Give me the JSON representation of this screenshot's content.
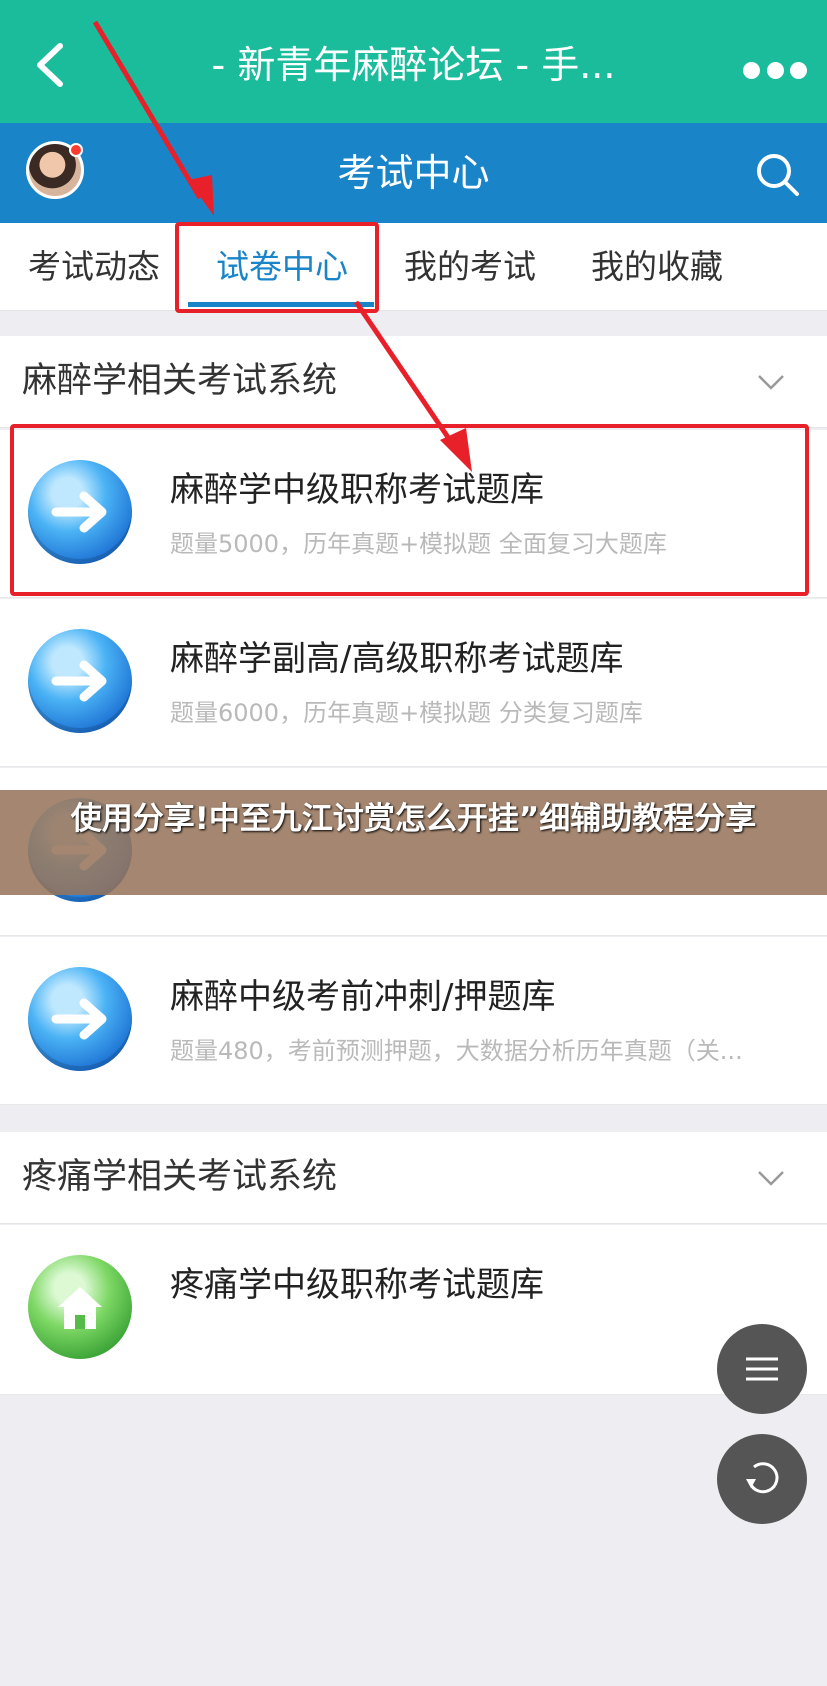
{
  "topbar": {
    "title": "- 新青年麻醉论坛 - 手..."
  },
  "header": {
    "title": "考试中心"
  },
  "tabs": [
    {
      "label": "考试动态"
    },
    {
      "label": "试卷中心"
    },
    {
      "label": "我的考试"
    },
    {
      "label": "我的收藏"
    }
  ],
  "sections": [
    {
      "title": "麻醉学相关考试系统",
      "items": [
        {
          "title": "麻醉学中级职称考试题库",
          "subtitle": "题量5000，历年真题+模拟题 全面复习大题库"
        },
        {
          "title": "麻醉学副高/高级职称考试题库",
          "subtitle": "题量6000，历年真题+模拟题 分类复习题库"
        },
        {
          "title": "麻醉中级考前冲刺/押题库",
          "subtitle": "题量480，考前预测押题，大数据分析历年真题（关..."
        }
      ]
    },
    {
      "title": "疼痛学相关考试系统",
      "items": [
        {
          "title": "疼痛学中级职称考试题库"
        }
      ]
    }
  ],
  "overlay": {
    "text": "使用分享!中至九江讨赏怎么开挂”细辅助教程分享"
  },
  "colors": {
    "teal": "#1abc9c",
    "blue": "#1a84c9",
    "annotation_red": "#e8202a"
  }
}
